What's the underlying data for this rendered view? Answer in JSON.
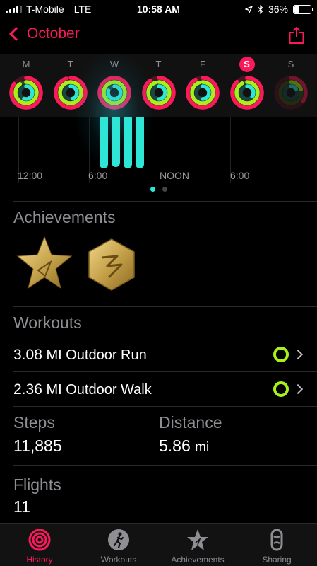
{
  "status": {
    "carrier": "T-Mobile",
    "network": "LTE",
    "time": "10:58 AM",
    "battery": "36%",
    "battery_level": 0.36
  },
  "nav": {
    "back_label": "October",
    "share_icon": "share-icon"
  },
  "week": {
    "days": [
      {
        "letter": "M",
        "today": false
      },
      {
        "letter": "T",
        "today": false
      },
      {
        "letter": "W",
        "today": false
      },
      {
        "letter": "T",
        "today": false
      },
      {
        "letter": "F",
        "today": false
      },
      {
        "letter": "S",
        "today": true
      },
      {
        "letter": "S",
        "today": false
      }
    ]
  },
  "timeline": {
    "labels": [
      "12:00",
      "6:00",
      "NOON",
      "6:00"
    ],
    "page_count": 2,
    "page_active": 0
  },
  "achievements": {
    "title": "Achievements",
    "badges": [
      "star-badge-icon",
      "hexagon-badge-icon"
    ]
  },
  "workouts": {
    "title": "Workouts",
    "items": [
      {
        "distance": "3.08",
        "unit": "MI",
        "name": "Outdoor Run"
      },
      {
        "distance": "2.36",
        "unit": "MI",
        "name": "Outdoor Walk"
      }
    ]
  },
  "stats": {
    "steps_label": "Steps",
    "steps_value": "11,885",
    "distance_label": "Distance",
    "distance_value": "5.86",
    "distance_unit": "mi",
    "flights_label": "Flights",
    "flights_value": "11"
  },
  "tabbar": {
    "items": [
      {
        "label": "History",
        "icon": "history-rings-icon",
        "active": true
      },
      {
        "label": "Workouts",
        "icon": "runner-icon",
        "active": false
      },
      {
        "label": "Achievements",
        "icon": "achievement-star-icon",
        "active": false
      },
      {
        "label": "Sharing",
        "icon": "sharing-icon",
        "active": false
      }
    ]
  },
  "colors": {
    "accent": "#fa1a5a",
    "move": "#fa1a5a",
    "exercise": "#a7f01b",
    "stand": "#2ee6d6"
  }
}
